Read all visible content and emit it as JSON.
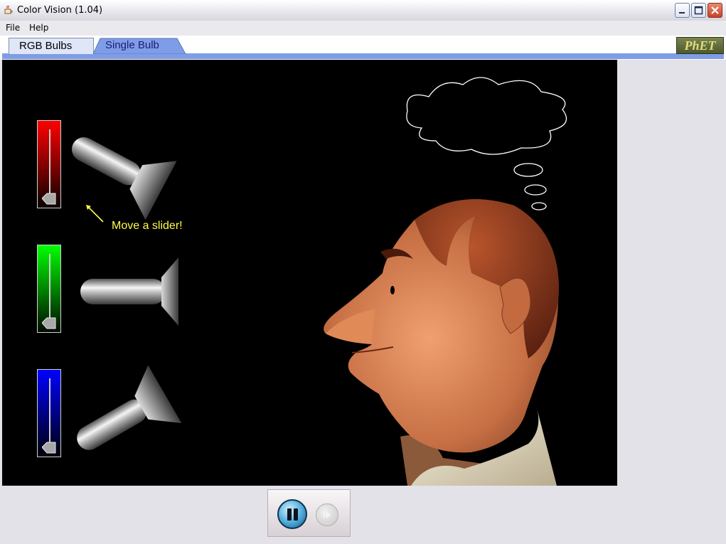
{
  "window": {
    "title": "Color Vision (1.04)",
    "controls": [
      "minimize",
      "maximize",
      "close"
    ]
  },
  "menu": {
    "items": [
      {
        "label": "File"
      },
      {
        "label": "Help"
      }
    ]
  },
  "tabs": [
    {
      "label": "RGB Bulbs",
      "selected": true
    },
    {
      "label": "Single Bulb",
      "selected": false
    }
  ],
  "logo": {
    "text": "PhET"
  },
  "play_area": {
    "hint": "Move a slider!",
    "sliders": [
      {
        "color": "#ff0000",
        "name": "red",
        "value": 0
      },
      {
        "color": "#00ff00",
        "name": "green",
        "value": 0
      },
      {
        "color": "#0000ff",
        "name": "blue",
        "value": 0
      }
    ]
  },
  "controls": {
    "pause_icon": "pause-icon",
    "step_icon": "step-icon"
  }
}
